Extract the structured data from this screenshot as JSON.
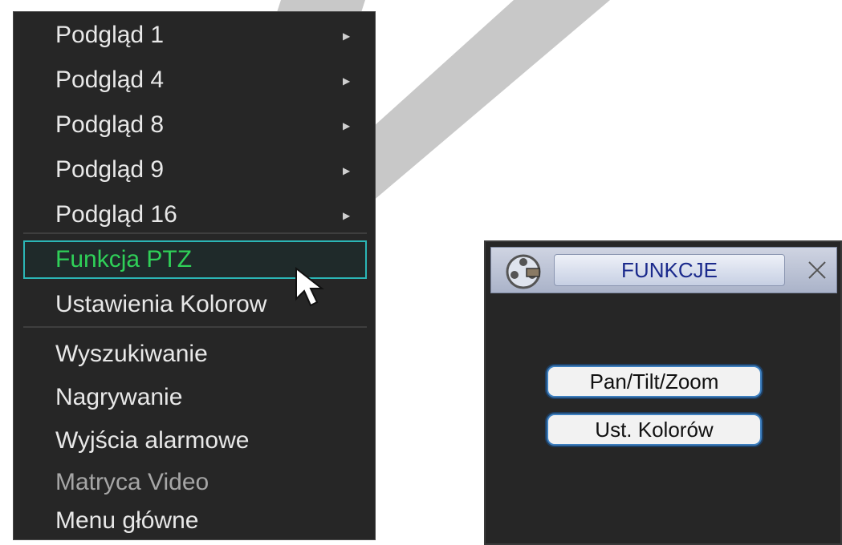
{
  "context_menu": {
    "items": [
      {
        "label": "Podgląd 1",
        "has_submenu": true
      },
      {
        "label": "Podgląd 4",
        "has_submenu": true
      },
      {
        "label": "Podgląd 8",
        "has_submenu": true
      },
      {
        "label": "Podgląd 9",
        "has_submenu": true
      },
      {
        "label": "Podgląd 16",
        "has_submenu": true
      },
      {
        "label": "Funkcja PTZ",
        "selected": true
      },
      {
        "label": "Ustawienia Kolorow"
      },
      {
        "label": "Wyszukiwanie"
      },
      {
        "label": "Nagrywanie"
      },
      {
        "label": "Wyjścia alarmowe"
      },
      {
        "label": "Matryca Video",
        "disabled": true
      },
      {
        "label": "Menu główne"
      }
    ]
  },
  "dialog": {
    "title": "FUNKCJE",
    "buttons": [
      {
        "label": "Pan/Tilt/Zoom"
      },
      {
        "label": "Ust. Kolorów"
      }
    ]
  },
  "colors": {
    "menu_bg": "#262626",
    "highlight_border": "#2bb6b6",
    "highlight_text": "#2fd058",
    "title_text": "#1b2a8c",
    "button_border": "#3d7fbf"
  },
  "icons": [
    "submenu-arrow-icon",
    "mouse-pointer-icon",
    "film-reel-icon",
    "close-icon"
  ]
}
